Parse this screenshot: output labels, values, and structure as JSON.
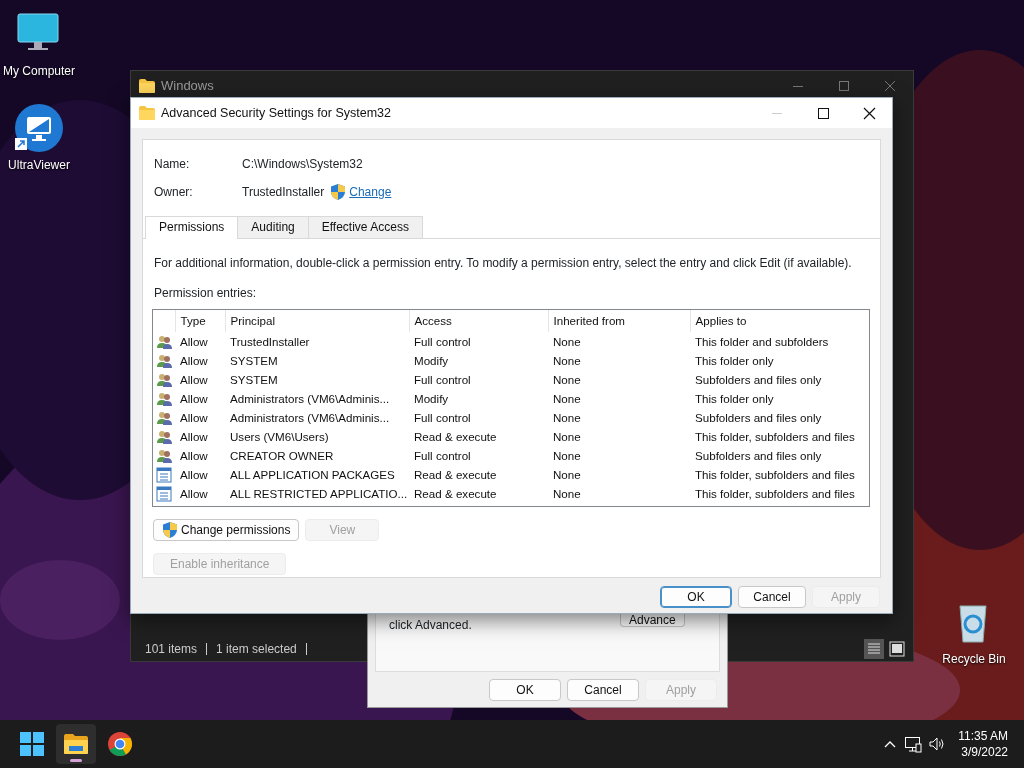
{
  "desktop_icons": [
    {
      "kind": "computer",
      "label": "My Computer"
    },
    {
      "kind": "viewer",
      "label": "UltraViewer"
    },
    {
      "kind": "recycle",
      "label": "Recycle Bin"
    }
  ],
  "explorer_window": {
    "title": "Windows",
    "status_items": [
      "101 items",
      "1 item selected"
    ]
  },
  "properties_dialog": {
    "text": "click Advanced.",
    "advanced_button": "Advance",
    "buttons": [
      {
        "label": "OK",
        "disabled": false
      },
      {
        "label": "Cancel",
        "disabled": false
      },
      {
        "label": "Apply",
        "disabled": true
      }
    ]
  },
  "security_dialog": {
    "title": "Advanced Security Settings for System32",
    "name_label": "Name:",
    "name_value": "C:\\Windows\\System32",
    "owner_label": "Owner:",
    "owner_value": "TrustedInstaller",
    "change_link": "Change",
    "tabs": [
      {
        "label": "Permissions",
        "selected": true
      },
      {
        "label": "Auditing",
        "selected": false
      },
      {
        "label": "Effective Access",
        "selected": false
      }
    ],
    "info": "For additional information, double-click a permission entry. To modify a permission entry, select the entry and click Edit (if available).",
    "entries_label": "Permission entries:",
    "columns": [
      "Type",
      "Principal",
      "Access",
      "Inherited from",
      "Applies to"
    ],
    "rows": [
      {
        "kind": "user",
        "type": "Allow",
        "principal": "TrustedInstaller",
        "access": "Full control",
        "inherited_from": "None",
        "applies_to": "This folder and subfolders"
      },
      {
        "kind": "user",
        "type": "Allow",
        "principal": "SYSTEM",
        "access": "Modify",
        "inherited_from": "None",
        "applies_to": "This folder only"
      },
      {
        "kind": "user",
        "type": "Allow",
        "principal": "SYSTEM",
        "access": "Full control",
        "inherited_from": "None",
        "applies_to": "Subfolders and files only"
      },
      {
        "kind": "user",
        "type": "Allow",
        "principal": "Administrators (VM6\\Adminis...",
        "access": "Modify",
        "inherited_from": "None",
        "applies_to": "This folder only"
      },
      {
        "kind": "user",
        "type": "Allow",
        "principal": "Administrators (VM6\\Adminis...",
        "access": "Full control",
        "inherited_from": "None",
        "applies_to": "Subfolders and files only"
      },
      {
        "kind": "user",
        "type": "Allow",
        "principal": "Users (VM6\\Users)",
        "access": "Read & execute",
        "inherited_from": "None",
        "applies_to": "This folder, subfolders and files"
      },
      {
        "kind": "user",
        "type": "Allow",
        "principal": "CREATOR OWNER",
        "access": "Full control",
        "inherited_from": "None",
        "applies_to": "Subfolders and files only"
      },
      {
        "kind": "package",
        "type": "Allow",
        "principal": "ALL APPLICATION PACKAGES",
        "access": "Read & execute",
        "inherited_from": "None",
        "applies_to": "This folder, subfolders and files"
      },
      {
        "kind": "package",
        "type": "Allow",
        "principal": "ALL RESTRICTED APPLICATIO...",
        "access": "Read & execute",
        "inherited_from": "None",
        "applies_to": "This folder, subfolders and files"
      }
    ],
    "change_permissions": {
      "label": "Change permissions",
      "disabled": false
    },
    "view_button": {
      "label": "View",
      "disabled": true
    },
    "inheritance_button": {
      "label": "Enable inheritance",
      "disabled": true
    },
    "buttons": [
      {
        "label": "OK",
        "focused": true,
        "disabled": false
      },
      {
        "label": "Cancel",
        "focused": false,
        "disabled": false
      },
      {
        "label": "Apply",
        "focused": false,
        "disabled": true
      }
    ]
  },
  "taskbar": {
    "apps": [
      {
        "kind": "start",
        "active": false
      },
      {
        "kind": "explorer",
        "active": true
      },
      {
        "kind": "chrome",
        "active": false
      }
    ],
    "time": "11:35 AM",
    "date": "3/9/2022"
  }
}
